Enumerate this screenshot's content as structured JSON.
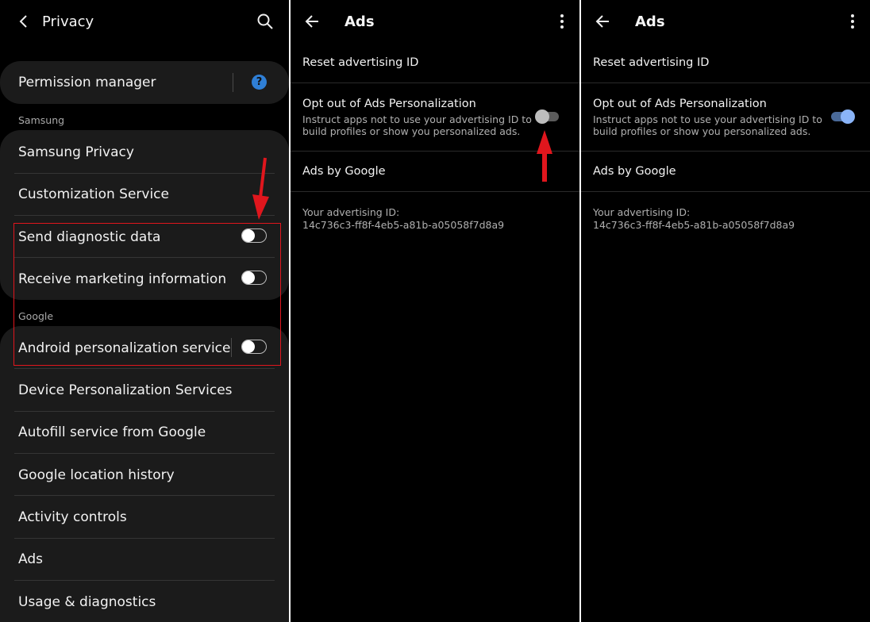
{
  "privacy": {
    "title": "Privacy",
    "permission_manager": "Permission manager",
    "samsung_label": "Samsung",
    "samsung_items": [
      "Samsung Privacy",
      "Customization Service"
    ],
    "toggle_items": [
      "Send diagnostic data",
      "Receive marketing information"
    ],
    "google_label": "Google",
    "android_personalization": "Android personalization service",
    "google_items": [
      "Device Personalization Services",
      "Autofill service from Google",
      "Google location history",
      "Activity controls",
      "Ads",
      "Usage & diagnostics"
    ],
    "help_glyph": "?"
  },
  "ads_before": {
    "title": "Ads",
    "reset_id": "Reset advertising ID",
    "opt_out_title": "Opt out of Ads Personalization",
    "opt_out_desc": "Instruct apps not to use your advertising ID to build profiles or show you personalized ads.",
    "opt_out_on": false,
    "ads_by_google": "Ads by Google",
    "id_label": "Your advertising ID:",
    "id_value": "14c736c3-ff8f-4eb5-a81b-a05058f7d8a9"
  },
  "ads_after": {
    "title": "Ads",
    "reset_id": "Reset advertising ID",
    "opt_out_title": "Opt out of Ads Personalization",
    "opt_out_desc": "Instruct apps not to use your advertising ID to build profiles or show you personalized ads.",
    "opt_out_on": true,
    "ads_by_google": "Ads by Google",
    "id_label": "Your advertising ID:",
    "id_value": "14c736c3-ff8f-4eb5-a81b-a05058f7d8a9"
  },
  "colors": {
    "annotation_red": "#e0161d",
    "toggle_on": "#8ab4f8",
    "help_blue": "#2f7fd6"
  },
  "icons": [
    "back-chevron-icon",
    "search-icon",
    "help-icon",
    "back-arrow-icon",
    "more-vert-icon",
    "red-arrow-down-icon",
    "red-arrow-up-icon"
  ]
}
